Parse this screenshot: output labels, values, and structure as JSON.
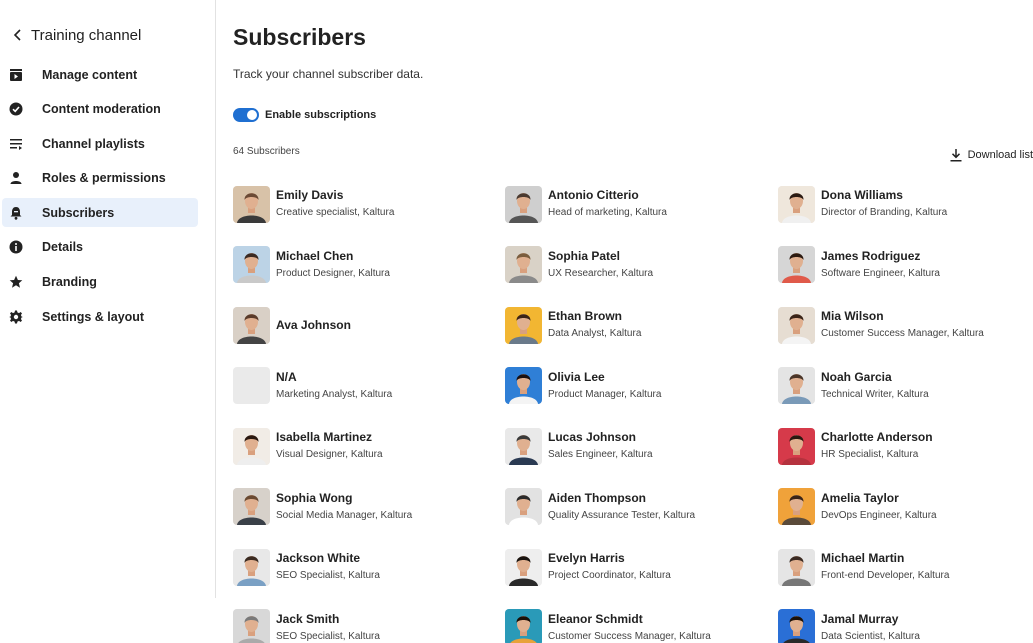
{
  "sidebar": {
    "back_title": "Training channel",
    "items": [
      {
        "label": "Manage content",
        "icon": "video-play-icon",
        "active": false
      },
      {
        "label": "Content moderation",
        "icon": "check-circle-icon",
        "active": false
      },
      {
        "label": "Channel playlists",
        "icon": "playlist-icon",
        "active": false
      },
      {
        "label": "Roles & permissions",
        "icon": "person-icon",
        "active": false
      },
      {
        "label": "Subscribers",
        "icon": "bell-icon",
        "active": true
      },
      {
        "label": "Details",
        "icon": "info-icon",
        "active": false
      },
      {
        "label": "Branding",
        "icon": "star-icon",
        "active": false
      },
      {
        "label": "Settings & layout",
        "icon": "gear-icon",
        "active": false
      }
    ]
  },
  "main": {
    "title": "Subscribers",
    "subtitle": "Track your channel subscriber data.",
    "toggle_label": "Enable subscriptions",
    "toggle_on": true,
    "count": "64 Subscribers",
    "download_label": "Download list"
  },
  "colors": {
    "accent": "#1f6fd1",
    "active_bg": "#e8f0fb"
  },
  "subscribers": [
    {
      "name": "Emily Davis",
      "role": "Creative specialist, Kaltura",
      "avatar": "photo"
    },
    {
      "name": "Antonio Citterio",
      "role": "Head of marketing, Kaltura",
      "avatar": "photo"
    },
    {
      "name": "Dona Williams",
      "role": "Director of Branding, Kaltura",
      "avatar": "photo"
    },
    {
      "name": "Michael Chen",
      "role": "Product Designer, Kaltura",
      "avatar": "photo"
    },
    {
      "name": "Sophia Patel",
      "role": "UX Researcher, Kaltura",
      "avatar": "photo"
    },
    {
      "name": "James Rodriguez",
      "role": "Software Engineer, Kaltura",
      "avatar": "photo"
    },
    {
      "name": "Ava Johnson",
      "role": "",
      "avatar": "photo"
    },
    {
      "name": "Ethan Brown",
      "role": "Data Analyst, Kaltura",
      "avatar": "photo"
    },
    {
      "name": "Mia Wilson",
      "role": "Customer Success Manager, Kaltura",
      "avatar": "photo"
    },
    {
      "name": "N/A",
      "role": "Marketing Analyst, Kaltura",
      "avatar": "empty"
    },
    {
      "name": "Olivia Lee",
      "role": "Product Manager, Kaltura",
      "avatar": "photo"
    },
    {
      "name": "Noah Garcia",
      "role": "Technical Writer, Kaltura",
      "avatar": "photo"
    },
    {
      "name": "Isabella Martinez",
      "role": "Visual Designer, Kaltura",
      "avatar": "photo"
    },
    {
      "name": "Lucas Johnson",
      "role": "Sales Engineer, Kaltura",
      "avatar": "photo"
    },
    {
      "name": "Charlotte Anderson",
      "role": "HR Specialist, Kaltura",
      "avatar": "photo"
    },
    {
      "name": "Sophia Wong",
      "role": "Social Media Manager, Kaltura",
      "avatar": "photo"
    },
    {
      "name": "Aiden Thompson",
      "role": "Quality Assurance Tester, Kaltura",
      "avatar": "photo"
    },
    {
      "name": "Amelia Taylor",
      "role": "DevOps Engineer, Kaltura",
      "avatar": "photo"
    },
    {
      "name": "Jackson White",
      "role": "SEO Specialist, Kaltura",
      "avatar": "photo"
    },
    {
      "name": "Evelyn Harris",
      "role": "Project Coordinator, Kaltura",
      "avatar": "photo"
    },
    {
      "name": "Michael Martin",
      "role": "Front-end Developer, Kaltura",
      "avatar": "photo"
    },
    {
      "name": "Jack Smith",
      "role": "SEO Specialist, Kaltura",
      "avatar": "photo"
    },
    {
      "name": "Eleanor Schmidt",
      "role": "Customer Success Manager, Kaltura",
      "avatar": "photo"
    },
    {
      "name": "Jamal Murray",
      "role": "Data Scientist, Kaltura",
      "avatar": "photo"
    }
  ]
}
